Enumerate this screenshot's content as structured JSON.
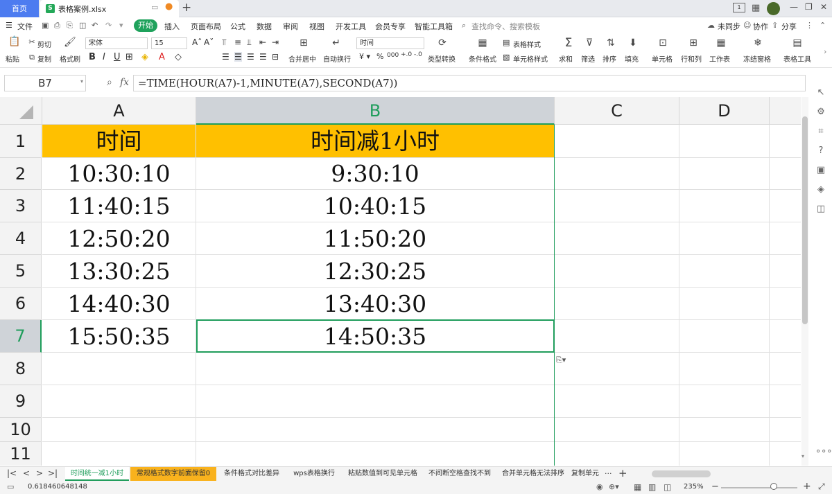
{
  "titlebar": {
    "home_tab": "首页",
    "file_tab": "表格案例.xlsx",
    "add_tab": "+",
    "window_buttons": {
      "minimize": "—",
      "restore": "❐",
      "close": "✕"
    }
  },
  "menubar": {
    "file_menu": "文件",
    "start": "开始",
    "items": [
      "插入",
      "页面布局",
      "公式",
      "数据",
      "审阅",
      "视图",
      "开发工具",
      "会员专享",
      "智能工具箱"
    ],
    "search_placeholder": "查找命令、搜索模板",
    "sync": "未同步",
    "collab": "协作",
    "share": "分享"
  },
  "toolbar": {
    "cut": "剪切",
    "paste": "粘贴",
    "copy": "复制",
    "format_painter": "格式刷",
    "font_name": "宋体",
    "font_size": "15",
    "merge_center": "合并居中",
    "wrap_text": "自动换行",
    "number_format": "时间",
    "type_convert": "类型转换",
    "conditional_format": "条件格式",
    "table_style": "表格样式",
    "cell_style": "单元格样式",
    "sum": "求和",
    "filter": "筛选",
    "sort": "排序",
    "fill": "填充",
    "cell": "单元格",
    "row_col": "行和列",
    "worksheet": "工作表",
    "freeze": "冻结窗格",
    "table_tools": "表格工具"
  },
  "formula_bar": {
    "name_box": "B7",
    "fx": "fx",
    "formula": "=TIME(HOUR(A7)-1,MINUTE(A7),SECOND(A7))"
  },
  "sheet": {
    "columns": [
      "A",
      "B",
      "C",
      "D"
    ],
    "active_column": "B",
    "active_row": "7",
    "rows": [
      {
        "num": "1",
        "a": "时间",
        "b": "时间减1小时"
      },
      {
        "num": "2",
        "a": "10:30:10",
        "b": "9:30:10"
      },
      {
        "num": "3",
        "a": "11:40:15",
        "b": "10:40:15"
      },
      {
        "num": "4",
        "a": "12:50:20",
        "b": "11:50:20"
      },
      {
        "num": "5",
        "a": "13:30:25",
        "b": "12:30:25"
      },
      {
        "num": "6",
        "a": "14:40:30",
        "b": "13:40:30"
      },
      {
        "num": "7",
        "a": "15:50:35",
        "b": "14:50:35"
      },
      {
        "num": "8",
        "a": "",
        "b": ""
      },
      {
        "num": "9",
        "a": "",
        "b": ""
      },
      {
        "num": "10",
        "a": "",
        "b": ""
      },
      {
        "num": "11",
        "a": "",
        "b": ""
      }
    ],
    "header_fill": "#ffc000",
    "selection_color": "#1f9d5b"
  },
  "sheet_tabs": {
    "tabs": [
      "时间统一减1小时",
      "常规格式数字前面保留0",
      "条件格式对比差异",
      "wps表格换行",
      "粘贴数值到可见单元格",
      "不间断空格查找不到",
      "合并单元格无法排序",
      "复制单元"
    ],
    "active_index": 0,
    "more": "···",
    "add": "+"
  },
  "statusbar": {
    "value": "0.618460648148",
    "zoom": "235%"
  }
}
